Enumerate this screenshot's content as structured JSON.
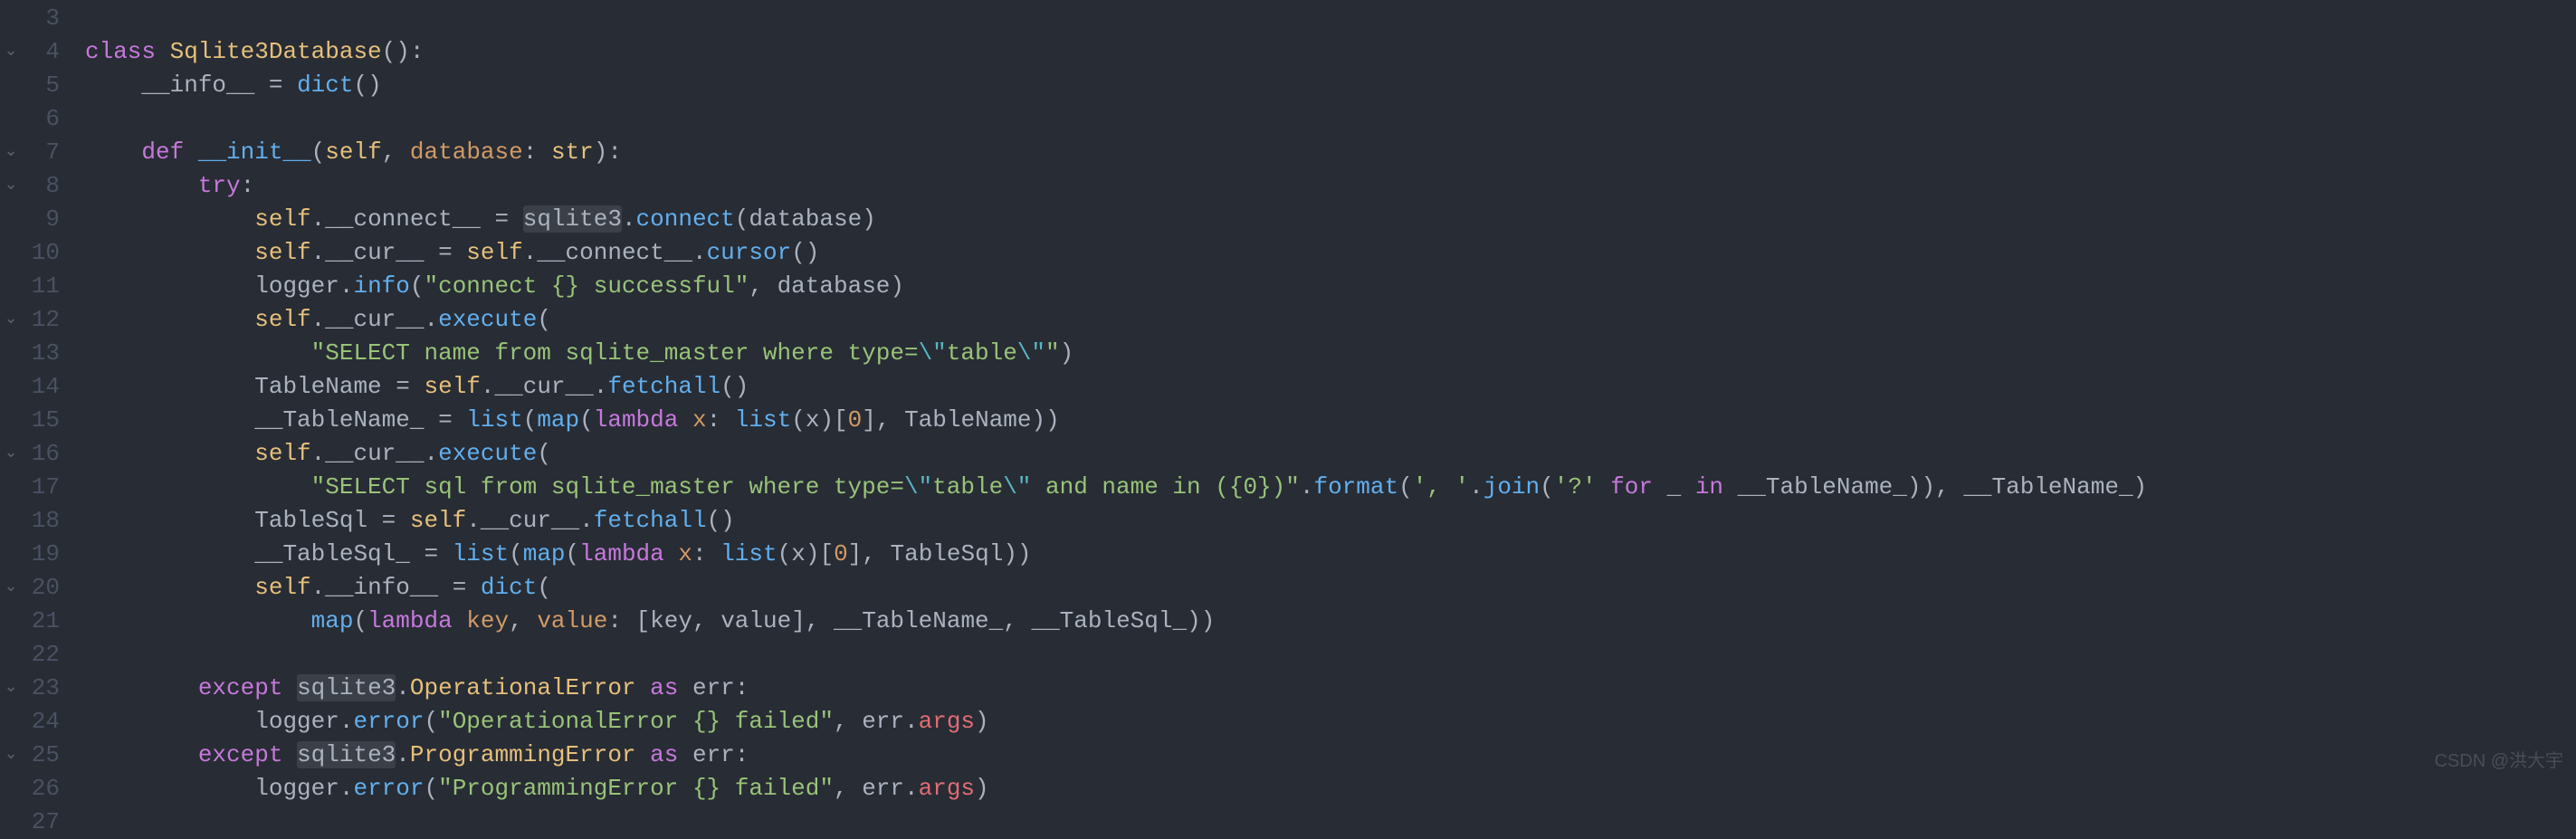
{
  "watermark": "CSDN @洪大宇",
  "lines": [
    {
      "n": 3,
      "fold": "",
      "tokens": []
    },
    {
      "n": 4,
      "fold": "⌄",
      "tokens": [
        {
          "c": "kw",
          "t": "class"
        },
        {
          "c": "op",
          "t": " "
        },
        {
          "c": "cls",
          "t": "Sqlite3Database"
        },
        {
          "c": "punc",
          "t": "():"
        }
      ]
    },
    {
      "n": 5,
      "fold": "",
      "indent": 1,
      "tokens": [
        {
          "c": "var",
          "t": "__info__"
        },
        {
          "c": "op",
          "t": " = "
        },
        {
          "c": "fn",
          "t": "dict"
        },
        {
          "c": "punc",
          "t": "()"
        }
      ]
    },
    {
      "n": 6,
      "fold": "",
      "tokens": []
    },
    {
      "n": 7,
      "fold": "⌄",
      "indent": 1,
      "tokens": [
        {
          "c": "kw",
          "t": "def"
        },
        {
          "c": "op",
          "t": " "
        },
        {
          "c": "fn",
          "t": "__init__"
        },
        {
          "c": "punc",
          "t": "("
        },
        {
          "c": "self",
          "t": "self"
        },
        {
          "c": "punc",
          "t": ", "
        },
        {
          "c": "param",
          "t": "database"
        },
        {
          "c": "punc",
          "t": ": "
        },
        {
          "c": "self",
          "t": "str"
        },
        {
          "c": "punc",
          "t": "):"
        }
      ]
    },
    {
      "n": 8,
      "fold": "⌄",
      "indent": 2,
      "tokens": [
        {
          "c": "kw",
          "t": "try"
        },
        {
          "c": "punc",
          "t": ":"
        }
      ]
    },
    {
      "n": 9,
      "fold": "",
      "indent": 3,
      "tokens": [
        {
          "c": "self",
          "t": "self"
        },
        {
          "c": "punc",
          "t": "."
        },
        {
          "c": "var",
          "t": "__connect__"
        },
        {
          "c": "op",
          "t": " = "
        },
        {
          "c": "var hl",
          "t": "sqlite3"
        },
        {
          "c": "punc",
          "t": "."
        },
        {
          "c": "fn",
          "t": "connect"
        },
        {
          "c": "punc",
          "t": "("
        },
        {
          "c": "var",
          "t": "database"
        },
        {
          "c": "punc",
          "t": ")"
        }
      ]
    },
    {
      "n": 10,
      "fold": "",
      "indent": 3,
      "tokens": [
        {
          "c": "self",
          "t": "self"
        },
        {
          "c": "punc",
          "t": "."
        },
        {
          "c": "var",
          "t": "__cur__"
        },
        {
          "c": "op",
          "t": " = "
        },
        {
          "c": "self",
          "t": "self"
        },
        {
          "c": "punc",
          "t": "."
        },
        {
          "c": "var",
          "t": "__connect__"
        },
        {
          "c": "punc",
          "t": "."
        },
        {
          "c": "fn",
          "t": "cursor"
        },
        {
          "c": "punc",
          "t": "()"
        }
      ]
    },
    {
      "n": 11,
      "fold": "",
      "indent": 3,
      "tokens": [
        {
          "c": "var",
          "t": "logger"
        },
        {
          "c": "punc",
          "t": "."
        },
        {
          "c": "fn",
          "t": "info"
        },
        {
          "c": "punc",
          "t": "("
        },
        {
          "c": "str",
          "t": "\"connect {} successful\""
        },
        {
          "c": "punc",
          "t": ", "
        },
        {
          "c": "var",
          "t": "database"
        },
        {
          "c": "punc",
          "t": ")"
        }
      ]
    },
    {
      "n": 12,
      "fold": "⌄",
      "indent": 3,
      "tokens": [
        {
          "c": "self",
          "t": "self"
        },
        {
          "c": "punc",
          "t": "."
        },
        {
          "c": "var",
          "t": "__cur__"
        },
        {
          "c": "punc",
          "t": "."
        },
        {
          "c": "fn",
          "t": "execute"
        },
        {
          "c": "punc",
          "t": "("
        }
      ]
    },
    {
      "n": 13,
      "fold": "",
      "indent": 4,
      "tokens": [
        {
          "c": "str",
          "t": "\"SELECT name from sqlite_master where type="
        },
        {
          "c": "esc",
          "t": "\\\""
        },
        {
          "c": "str",
          "t": "table"
        },
        {
          "c": "esc",
          "t": "\\\""
        },
        {
          "c": "str",
          "t": "\""
        },
        {
          "c": "punc",
          "t": ")"
        }
      ]
    },
    {
      "n": 14,
      "fold": "",
      "indent": 3,
      "tokens": [
        {
          "c": "var",
          "t": "TableName"
        },
        {
          "c": "op",
          "t": " = "
        },
        {
          "c": "self",
          "t": "self"
        },
        {
          "c": "punc",
          "t": "."
        },
        {
          "c": "var",
          "t": "__cur__"
        },
        {
          "c": "punc",
          "t": "."
        },
        {
          "c": "fn",
          "t": "fetchall"
        },
        {
          "c": "punc",
          "t": "()"
        }
      ]
    },
    {
      "n": 15,
      "fold": "",
      "indent": 3,
      "tokens": [
        {
          "c": "var",
          "t": "__TableName_"
        },
        {
          "c": "op",
          "t": " = "
        },
        {
          "c": "fn",
          "t": "list"
        },
        {
          "c": "punc",
          "t": "("
        },
        {
          "c": "fn",
          "t": "map"
        },
        {
          "c": "punc",
          "t": "("
        },
        {
          "c": "kw",
          "t": "lambda"
        },
        {
          "c": "op",
          "t": " "
        },
        {
          "c": "param",
          "t": "x"
        },
        {
          "c": "punc",
          "t": ": "
        },
        {
          "c": "fn",
          "t": "list"
        },
        {
          "c": "punc",
          "t": "("
        },
        {
          "c": "var",
          "t": "x"
        },
        {
          "c": "punc",
          "t": ")["
        },
        {
          "c": "num",
          "t": "0"
        },
        {
          "c": "punc",
          "t": "], "
        },
        {
          "c": "var",
          "t": "TableName"
        },
        {
          "c": "punc",
          "t": "))"
        }
      ]
    },
    {
      "n": 16,
      "fold": "⌄",
      "indent": 3,
      "tokens": [
        {
          "c": "self",
          "t": "self"
        },
        {
          "c": "punc",
          "t": "."
        },
        {
          "c": "var",
          "t": "__cur__"
        },
        {
          "c": "punc",
          "t": "."
        },
        {
          "c": "fn",
          "t": "execute"
        },
        {
          "c": "punc",
          "t": "("
        }
      ]
    },
    {
      "n": 17,
      "fold": "",
      "indent": 4,
      "tokens": [
        {
          "c": "str",
          "t": "\"SELECT sql from sqlite_master where type="
        },
        {
          "c": "esc",
          "t": "\\\""
        },
        {
          "c": "str",
          "t": "table"
        },
        {
          "c": "esc",
          "t": "\\\""
        },
        {
          "c": "str",
          "t": " and name in ({0})\""
        },
        {
          "c": "punc",
          "t": "."
        },
        {
          "c": "fn",
          "t": "format"
        },
        {
          "c": "punc",
          "t": "("
        },
        {
          "c": "str",
          "t": "', '"
        },
        {
          "c": "punc",
          "t": "."
        },
        {
          "c": "fn",
          "t": "join"
        },
        {
          "c": "punc",
          "t": "("
        },
        {
          "c": "str",
          "t": "'?'"
        },
        {
          "c": "op",
          "t": " "
        },
        {
          "c": "kw",
          "t": "for"
        },
        {
          "c": "op",
          "t": " "
        },
        {
          "c": "var",
          "t": "_"
        },
        {
          "c": "op",
          "t": " "
        },
        {
          "c": "kw",
          "t": "in"
        },
        {
          "c": "op",
          "t": " "
        },
        {
          "c": "var",
          "t": "__TableName_"
        },
        {
          "c": "punc",
          "t": ")), "
        },
        {
          "c": "var",
          "t": "__TableName_"
        },
        {
          "c": "punc",
          "t": ")"
        }
      ]
    },
    {
      "n": 18,
      "fold": "",
      "indent": 3,
      "tokens": [
        {
          "c": "var",
          "t": "TableSql"
        },
        {
          "c": "op",
          "t": " = "
        },
        {
          "c": "self",
          "t": "self"
        },
        {
          "c": "punc",
          "t": "."
        },
        {
          "c": "var",
          "t": "__cur__"
        },
        {
          "c": "punc",
          "t": "."
        },
        {
          "c": "fn",
          "t": "fetchall"
        },
        {
          "c": "punc",
          "t": "()"
        }
      ]
    },
    {
      "n": 19,
      "fold": "",
      "indent": 3,
      "tokens": [
        {
          "c": "var",
          "t": "__TableSql_"
        },
        {
          "c": "op",
          "t": " = "
        },
        {
          "c": "fn",
          "t": "list"
        },
        {
          "c": "punc",
          "t": "("
        },
        {
          "c": "fn",
          "t": "map"
        },
        {
          "c": "punc",
          "t": "("
        },
        {
          "c": "kw",
          "t": "lambda"
        },
        {
          "c": "op",
          "t": " "
        },
        {
          "c": "param",
          "t": "x"
        },
        {
          "c": "punc",
          "t": ": "
        },
        {
          "c": "fn",
          "t": "list"
        },
        {
          "c": "punc",
          "t": "("
        },
        {
          "c": "var",
          "t": "x"
        },
        {
          "c": "punc",
          "t": ")["
        },
        {
          "c": "num",
          "t": "0"
        },
        {
          "c": "punc",
          "t": "], "
        },
        {
          "c": "var",
          "t": "TableSql"
        },
        {
          "c": "punc",
          "t": "))"
        }
      ]
    },
    {
      "n": 20,
      "fold": "⌄",
      "indent": 3,
      "tokens": [
        {
          "c": "self",
          "t": "self"
        },
        {
          "c": "punc",
          "t": "."
        },
        {
          "c": "var",
          "t": "__info__"
        },
        {
          "c": "op",
          "t": " = "
        },
        {
          "c": "fn",
          "t": "dict"
        },
        {
          "c": "punc",
          "t": "("
        }
      ]
    },
    {
      "n": 21,
      "fold": "",
      "indent": 4,
      "tokens": [
        {
          "c": "fn",
          "t": "map"
        },
        {
          "c": "punc",
          "t": "("
        },
        {
          "c": "kw",
          "t": "lambda"
        },
        {
          "c": "op",
          "t": " "
        },
        {
          "c": "param",
          "t": "key"
        },
        {
          "c": "punc",
          "t": ", "
        },
        {
          "c": "param",
          "t": "value"
        },
        {
          "c": "punc",
          "t": ": ["
        },
        {
          "c": "var",
          "t": "key"
        },
        {
          "c": "punc",
          "t": ", "
        },
        {
          "c": "var",
          "t": "value"
        },
        {
          "c": "punc",
          "t": "], "
        },
        {
          "c": "var",
          "t": "__TableName_"
        },
        {
          "c": "punc",
          "t": ", "
        },
        {
          "c": "var",
          "t": "__TableSql_"
        },
        {
          "c": "punc",
          "t": "))"
        }
      ]
    },
    {
      "n": 22,
      "fold": "",
      "tokens": []
    },
    {
      "n": 23,
      "fold": "⌄",
      "indent": 2,
      "tokens": [
        {
          "c": "kw",
          "t": "except"
        },
        {
          "c": "op",
          "t": " "
        },
        {
          "c": "var hl",
          "t": "sqlite3"
        },
        {
          "c": "punc",
          "t": "."
        },
        {
          "c": "cls",
          "t": "OperationalError"
        },
        {
          "c": "op",
          "t": " "
        },
        {
          "c": "kw",
          "t": "as"
        },
        {
          "c": "op",
          "t": " "
        },
        {
          "c": "var",
          "t": "err"
        },
        {
          "c": "punc",
          "t": ":"
        }
      ]
    },
    {
      "n": 24,
      "fold": "",
      "indent": 3,
      "tokens": [
        {
          "c": "var",
          "t": "logger"
        },
        {
          "c": "punc",
          "t": "."
        },
        {
          "c": "fn",
          "t": "error"
        },
        {
          "c": "punc",
          "t": "("
        },
        {
          "c": "str",
          "t": "\"OperationalError {} failed\""
        },
        {
          "c": "punc",
          "t": ", "
        },
        {
          "c": "var",
          "t": "err"
        },
        {
          "c": "punc",
          "t": "."
        },
        {
          "c": "attr",
          "t": "args"
        },
        {
          "c": "punc",
          "t": ")"
        }
      ]
    },
    {
      "n": 25,
      "fold": "⌄",
      "indent": 2,
      "tokens": [
        {
          "c": "kw",
          "t": "except"
        },
        {
          "c": "op",
          "t": " "
        },
        {
          "c": "var hl",
          "t": "sqlite3"
        },
        {
          "c": "punc",
          "t": "."
        },
        {
          "c": "cls",
          "t": "ProgrammingError"
        },
        {
          "c": "op",
          "t": " "
        },
        {
          "c": "kw",
          "t": "as"
        },
        {
          "c": "op",
          "t": " "
        },
        {
          "c": "var",
          "t": "err"
        },
        {
          "c": "punc",
          "t": ":"
        }
      ]
    },
    {
      "n": 26,
      "fold": "",
      "indent": 3,
      "tokens": [
        {
          "c": "var",
          "t": "logger"
        },
        {
          "c": "punc",
          "t": "."
        },
        {
          "c": "fn",
          "t": "error"
        },
        {
          "c": "punc",
          "t": "("
        },
        {
          "c": "str",
          "t": "\"ProgrammingError {} failed\""
        },
        {
          "c": "punc",
          "t": ", "
        },
        {
          "c": "var",
          "t": "err"
        },
        {
          "c": "punc",
          "t": "."
        },
        {
          "c": "attr",
          "t": "args"
        },
        {
          "c": "punc",
          "t": ")"
        }
      ]
    },
    {
      "n": 27,
      "fold": "",
      "tokens": []
    }
  ]
}
